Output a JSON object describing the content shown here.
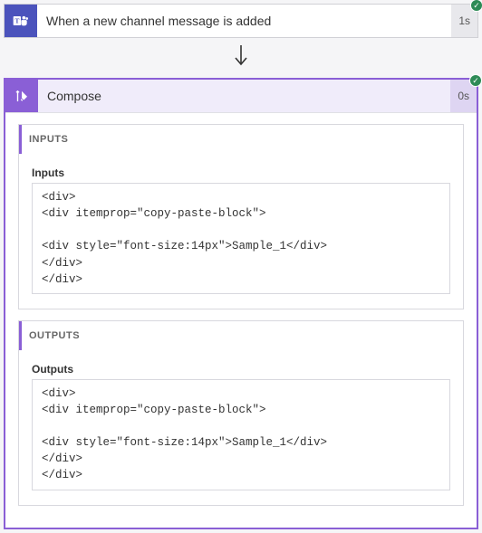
{
  "trigger": {
    "title": "When a new channel message is added",
    "duration": "1s",
    "status": "success"
  },
  "action": {
    "title": "Compose",
    "duration": "0s",
    "status": "success"
  },
  "sections": {
    "inputs": {
      "header": "INPUTS",
      "field_label": "Inputs",
      "code": "<div>\n<div itemprop=\"copy-paste-block\">\n\n<div style=\"font-size:14px\">Sample_1</div>\n</div>\n</div>"
    },
    "outputs": {
      "header": "OUTPUTS",
      "field_label": "Outputs",
      "code": "<div>\n<div itemprop=\"copy-paste-block\">\n\n<div style=\"font-size:14px\">Sample_1</div>\n</div>\n</div>"
    }
  }
}
